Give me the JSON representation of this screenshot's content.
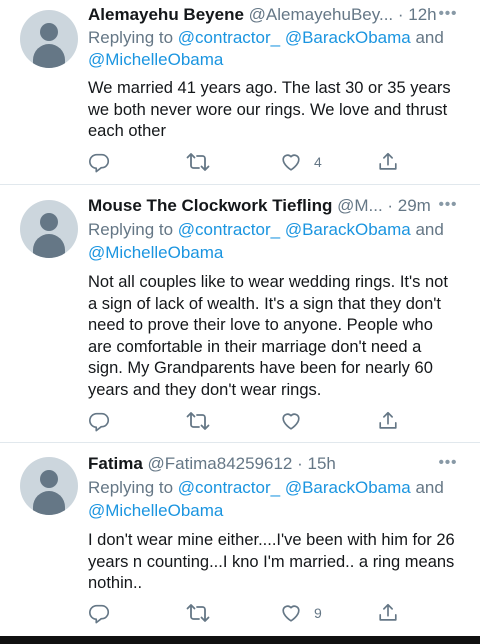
{
  "tweets": [
    {
      "name": "Alemayehu Beyene",
      "handle_time": "@AlemayehuBey... · 12h",
      "reply_prefix": "Replying to",
      "reply_mentions_line1": "@contractor_ @BarackObama",
      "reply_and": "and",
      "reply_mentions_line2": "@MichelleObama",
      "text": "We married 41 years ago. The last 30 or 35 years we both never wore our rings. We love and thrust each other",
      "likes": "4"
    },
    {
      "name": "Mouse The Clockwork Tiefling",
      "handle_time": "@M... · 29m",
      "reply_prefix": "Replying to",
      "reply_mentions_line1": "@contractor_ @BarackObama",
      "reply_and": "and",
      "reply_mentions_line2": "@MichelleObama",
      "text": "Not all couples like to wear wedding rings. It's not a sign of lack of wealth. It's a sign that they don't need to prove their love to anyone. People who are comfortable in their marriage don't need a sign. My Grandparents have been for nearly 60 years and they don't wear rings.",
      "likes": ""
    },
    {
      "name": "Fatima",
      "handle_time": "@Fatima84259612 · 15h",
      "reply_prefix": "Replying to",
      "reply_mentions_line1": "@contractor_ @BarackObama",
      "reply_and": "and",
      "reply_mentions_line2": "@MichelleObama",
      "text": "I don't wear mine either....I've been with him for 26 years n counting...I kno I'm married.. a ring means nothin..",
      "likes": "9"
    }
  ],
  "icons": {
    "more": "more-icon",
    "reply": "reply-icon",
    "retweet": "retweet-icon",
    "like": "heart-icon",
    "share": "share-icon",
    "avatar": "default-avatar"
  },
  "colors": {
    "mention": "#1b95e0",
    "secondary": "#657786",
    "icon": "#657786",
    "divider": "#e1e8ed"
  }
}
